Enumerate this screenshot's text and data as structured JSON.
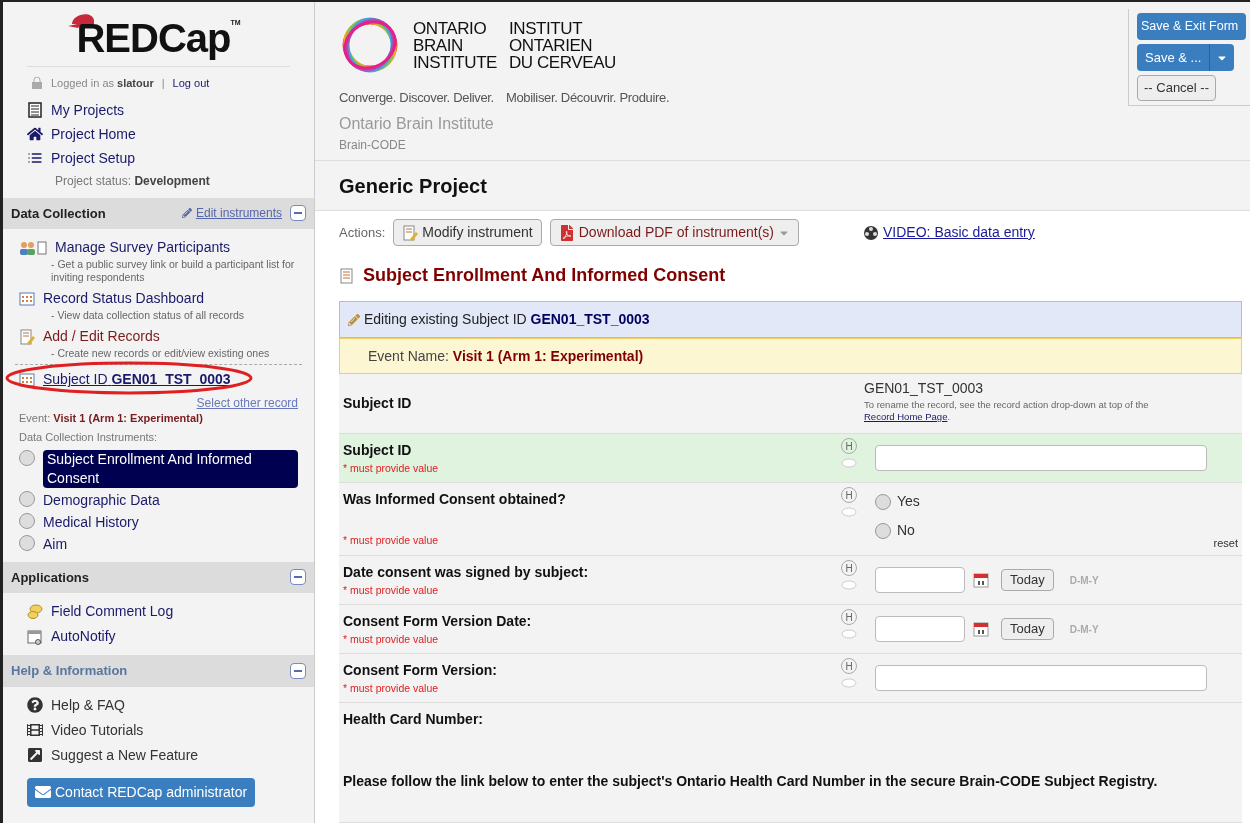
{
  "sidebar": {
    "logo": "REDCap",
    "logo_mark": "TM",
    "login": {
      "prefix": "Logged in as",
      "user": "slatour",
      "separator": "|",
      "logout": "Log out"
    },
    "nav": [
      {
        "label": "My Projects"
      },
      {
        "label": "Project Home"
      },
      {
        "label": "Project Setup"
      }
    ],
    "project_status": {
      "label": "Project status:",
      "value": "Development"
    },
    "data_collection": {
      "title": "Data Collection",
      "edit_link": "Edit instruments",
      "items": [
        {
          "label": "Manage Survey Participants",
          "description": "- Get a public survey link or build a participant list for inviting respondents"
        },
        {
          "label": "Record Status Dashboard",
          "description": "- View data collection status of all records"
        },
        {
          "label": "Add / Edit Records",
          "description": "- Create new records or edit/view existing ones"
        }
      ],
      "record": {
        "prefix": "Subject ID",
        "id": "GEN01_TST_0003",
        "select_other": "Select other record"
      },
      "event": {
        "label": "Event:",
        "value": "Visit 1 (Arm 1: Experimental)"
      },
      "instruments_label": "Data Collection Instruments:",
      "instruments": [
        {
          "label": "Subject Enrollment And Informed Consent",
          "selected": true,
          "checked": false
        },
        {
          "label": "Demographic Data",
          "selected": false,
          "checked": false
        },
        {
          "label": "Medical History",
          "selected": false,
          "checked": false
        },
        {
          "label": "Aim",
          "selected": false,
          "checked": false
        }
      ]
    },
    "applications": {
      "title": "Applications",
      "items": [
        {
          "label": "Field Comment Log"
        },
        {
          "label": "AutoNotify"
        }
      ]
    },
    "help": {
      "title": "Help & Information",
      "items": [
        {
          "label": "Help & FAQ"
        },
        {
          "label": "Video Tutorials"
        },
        {
          "label": "Suggest a New Feature"
        }
      ]
    },
    "contact_button": "Contact REDCap administrator"
  },
  "header": {
    "logo_en": [
      "ONTARIO",
      "BRAIN",
      "INSTITUTE"
    ],
    "logo_fr": [
      "INSTITUT",
      "ONTARIEN",
      "DU CERVEAU"
    ],
    "tagline_en": "Converge. Discover. Deliver.",
    "tagline_fr": "Mobiliser. Découvrir. Produire.",
    "org": "Ontario Brain Institute",
    "sub": "Brain-CODE"
  },
  "save_panel": {
    "save_exit": "Save & Exit Form",
    "save_more": "Save & ...",
    "cancel": "-- Cancel --"
  },
  "project_title": "Generic Project",
  "actions": {
    "label": "Actions:",
    "modify": "Modify instrument",
    "download": "Download PDF of instrument(s)",
    "video": "VIDEO: Basic data entry"
  },
  "form": {
    "title": "Subject Enrollment And Informed Consent",
    "editing": {
      "prefix": "Editing existing Subject ID",
      "id": "GEN01_TST_0003"
    },
    "event": {
      "label": "Event Name:",
      "value": "Visit 1 (Arm 1: Experimental)"
    },
    "fields": [
      {
        "kind": "readonly",
        "label": "Subject ID",
        "value": "GEN01_TST_0003",
        "note": "To rename the record, see the record action drop-down at top of the",
        "note_link": "Record Home Page",
        "note_end": "."
      },
      {
        "kind": "text",
        "label": "Subject ID",
        "required": "* must provide value",
        "highlight": true,
        "help": "H"
      },
      {
        "kind": "radio",
        "label": "Was Informed Consent obtained?",
        "required": "* must provide value",
        "highlight": false,
        "help": "H",
        "options": [
          {
            "label": "Yes",
            "selected": false
          },
          {
            "label": "No",
            "selected": false
          }
        ],
        "reset": "reset"
      },
      {
        "kind": "date",
        "label": "Date consent was signed by subject:",
        "required": "* must provide value",
        "highlight": false,
        "help": "H",
        "today": "Today",
        "format": "D-M-Y"
      },
      {
        "kind": "date",
        "label": "Consent Form Version Date:",
        "required": "* must provide value",
        "highlight": false,
        "help": "H",
        "today": "Today",
        "format": "D-M-Y"
      },
      {
        "kind": "text",
        "label": "Consent Form Version:",
        "required": "* must provide value",
        "highlight": false,
        "help": "H"
      },
      {
        "kind": "descriptive",
        "label": "Health Card Number:",
        "text": "Please follow the link below to enter the subject's Ontario Health Card Number in the secure Brain-CODE Subject Registry."
      }
    ]
  }
}
